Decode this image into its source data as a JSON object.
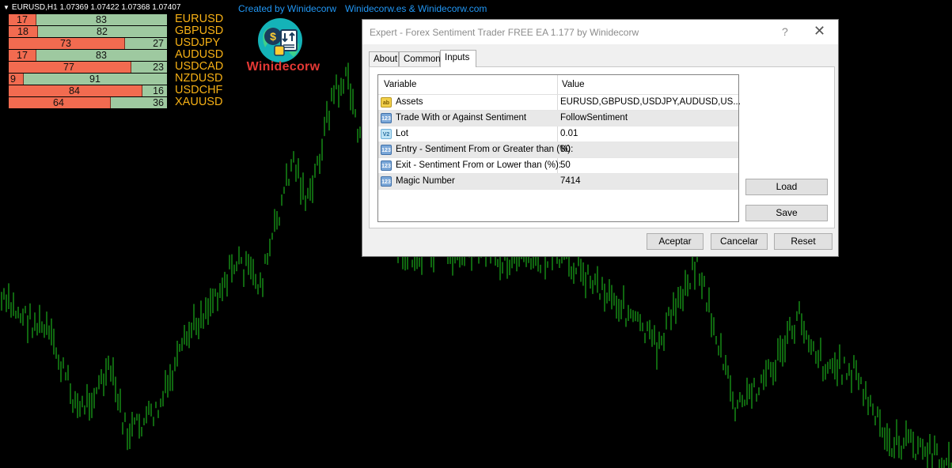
{
  "chart": {
    "header": "EURUSD,H1  1.07369 1.07422 1.07368 1.07407",
    "credit_left": "Created by Winidecorw",
    "credit_right": "Winidecorw.es  &  Winidecorw.com",
    "candle_color": "#1fce1f"
  },
  "sentiment": [
    {
      "symbol": "EURUSD",
      "short": 17,
      "long": 83
    },
    {
      "symbol": "GBPUSD",
      "short": 18,
      "long": 82
    },
    {
      "symbol": "USDJPY",
      "short": 73,
      "long": 27
    },
    {
      "symbol": "AUDUSD",
      "short": 17,
      "long": 83
    },
    {
      "symbol": "USDCAD",
      "short": 77,
      "long": 23
    },
    {
      "symbol": "NZDUSD",
      "short": 9,
      "long": 91
    },
    {
      "symbol": "USDCHF",
      "short": 84,
      "long": 16
    },
    {
      "symbol": "XAUUSD",
      "short": 64,
      "long": 36
    }
  ],
  "logo": {
    "text": "Winidecorw"
  },
  "dialog": {
    "title": "Expert - Forex Sentiment Trader FREE EA 1.177 by Winidecorw",
    "help": "?",
    "tabs": [
      "About",
      "Common",
      "Inputs"
    ],
    "active_tab": "Inputs",
    "columns": {
      "variable": "Variable",
      "value": "Value"
    },
    "rows": [
      {
        "icon": "ab",
        "name": "Assets",
        "value": "EURUSD,GBPUSD,USDJPY,AUDUSD,US..."
      },
      {
        "icon": "123",
        "name": "Trade With or Against Sentiment",
        "value": "FollowSentiment"
      },
      {
        "icon": "V2",
        "name": "Lot",
        "value": "0.01"
      },
      {
        "icon": "123",
        "name": "Entry - Sentiment From or Greater than (%):",
        "value": "80"
      },
      {
        "icon": "123",
        "name": "Exit - Sentiment From or Lower than (%):",
        "value": "50"
      },
      {
        "icon": "123",
        "name": "Magic Number",
        "value": "7414"
      }
    ],
    "load": "Load",
    "save": "Save",
    "ok": "Aceptar",
    "cancel": "Cancelar",
    "reset": "Reset"
  }
}
